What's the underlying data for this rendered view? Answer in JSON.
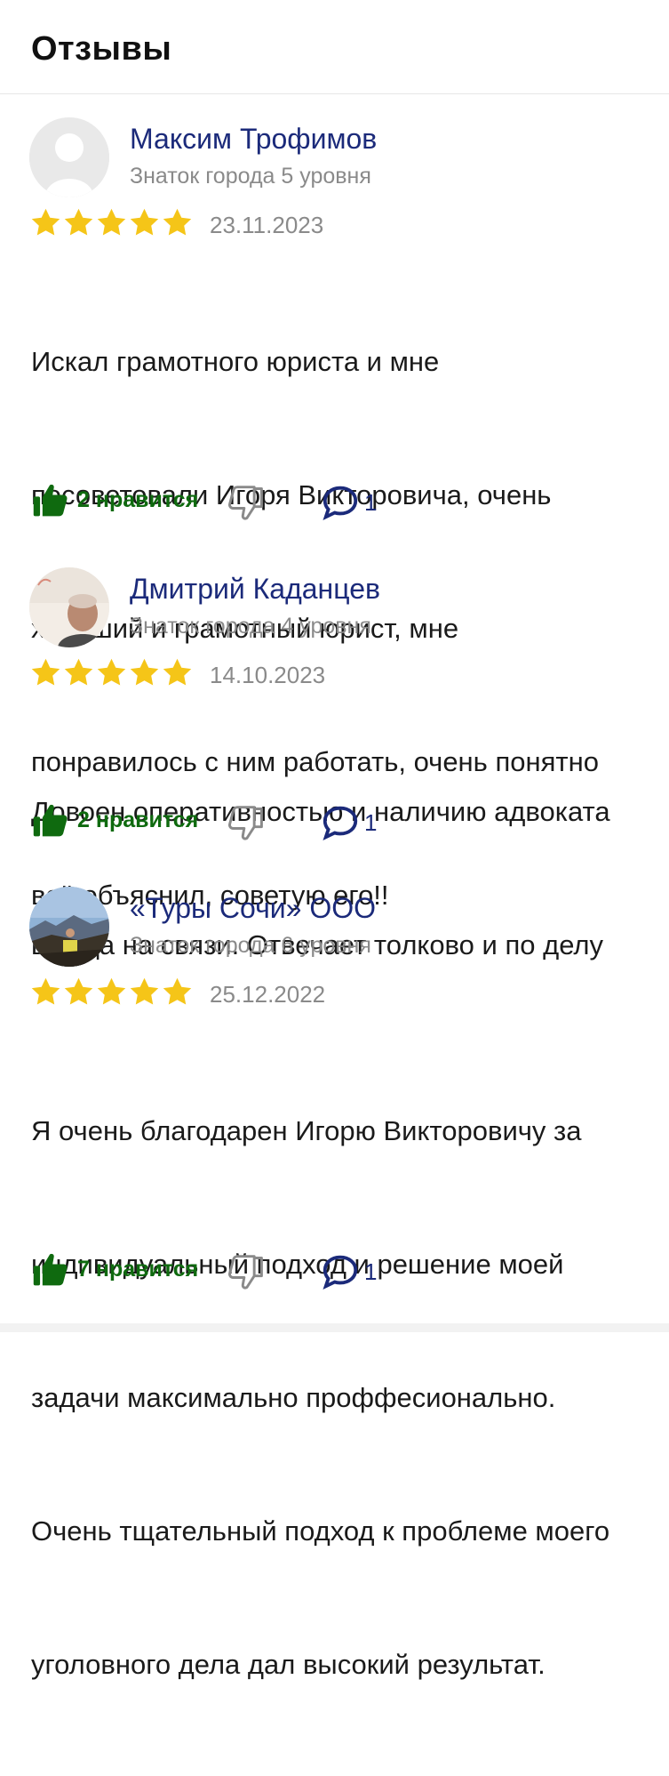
{
  "header": {
    "title": "Отзывы"
  },
  "colors": {
    "star": "#f5c518",
    "like": "#0f6a0f",
    "author": "#1b2a7a",
    "muted": "#8a8a8a"
  },
  "reviews": [
    {
      "author": "Максим Трофимов",
      "level": "Знаток города 5 уровня",
      "rating": 5,
      "date": "23.11.2023",
      "text_lines": [
        "Искал грамотного юриста и мне",
        "посоветовали Игоря Викторовича, очень",
        "хороший и грамотный юрист, мне",
        "понравилось с ним работать, очень понятно",
        "всё объяснил, советую его!!"
      ],
      "likes": "2 нравится",
      "comments": "1",
      "avatar": "default-avatar-icon"
    },
    {
      "author": "Дмитрий Каданцев",
      "level": "Знаток города 4 уровня",
      "rating": 5,
      "date": "14.10.2023",
      "text_lines": [
        "Довоен оперативностью и наличию адвоката",
        "всегда на связи. Отвечает толково и по делу"
      ],
      "likes": "2 нравится",
      "comments": "1",
      "avatar": "user-photo"
    },
    {
      "author": "«Туры Сочи» ООО",
      "level": "Знаток города 6 уровня",
      "rating": 5,
      "date": "25.12.2022",
      "text_lines": [
        "Я очень благодарен Игорю Викторовичу за",
        "индивидуальный подход и решение моей",
        "задачи максимально проффесионально.",
        "Очень тщательный подход к проблеме моего",
        "уголовного дела дал высокий результат."
      ],
      "likes": "7 нравится",
      "comments": "1",
      "avatar": "mountain-photo"
    }
  ]
}
